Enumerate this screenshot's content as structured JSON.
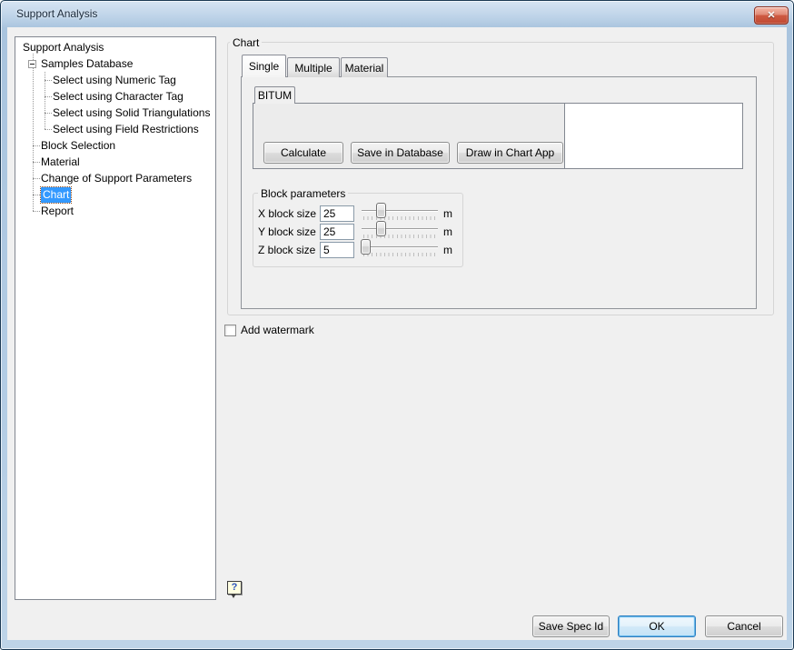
{
  "window": {
    "title": "Support Analysis",
    "close_icon": "✕"
  },
  "tree": {
    "items": [
      {
        "label": "Support Analysis",
        "level": 0
      },
      {
        "label": "Samples Database",
        "level": 1,
        "expanded": true
      },
      {
        "label": "Select using Numeric Tag",
        "level": 2
      },
      {
        "label": "Select using Character Tag",
        "level": 2
      },
      {
        "label": "Select using Solid Triangulations",
        "level": 2
      },
      {
        "label": "Select using Field Restrictions",
        "level": 2
      },
      {
        "label": "Block Selection",
        "level": 1
      },
      {
        "label": "Material",
        "level": 1
      },
      {
        "label": "Change of Support Parameters",
        "level": 1
      },
      {
        "label": "Chart",
        "level": 1,
        "selected": true
      },
      {
        "label": "Report",
        "level": 1
      }
    ]
  },
  "chart": {
    "group_label": "Chart",
    "tabs": [
      "Single",
      "Multiple",
      "Material"
    ],
    "active_tab": "Single",
    "sample_tabs": [
      "BITUM"
    ],
    "active_sample_tab": "BITUM",
    "actions": {
      "calculate": "Calculate",
      "save_in_database": "Save in Database",
      "draw_in_chart_app": "Draw in Chart App"
    },
    "block_parameters": {
      "group_label": "Block parameters",
      "slider_min": 0,
      "slider_max": 100,
      "rows": [
        {
          "label": "X block size",
          "value": "25",
          "unit": "m"
        },
        {
          "label": "Y block size",
          "value": "25",
          "unit": "m"
        },
        {
          "label": "Z block size",
          "value": "5",
          "unit": "m"
        }
      ]
    }
  },
  "watermark": {
    "label": "Add watermark",
    "checked": false
  },
  "help": {
    "icon": "?"
  },
  "footer": {
    "save_spec_id": "Save Spec Id",
    "ok": "OK",
    "cancel": "Cancel"
  },
  "colors": {
    "selection_blue": "#3399ff",
    "titlebar_blue": "#b3cce4",
    "close_button_red": "#cf5a42",
    "ok_focus_blue": "#2f7fc1",
    "dialog_background": "#f0f0f0"
  }
}
